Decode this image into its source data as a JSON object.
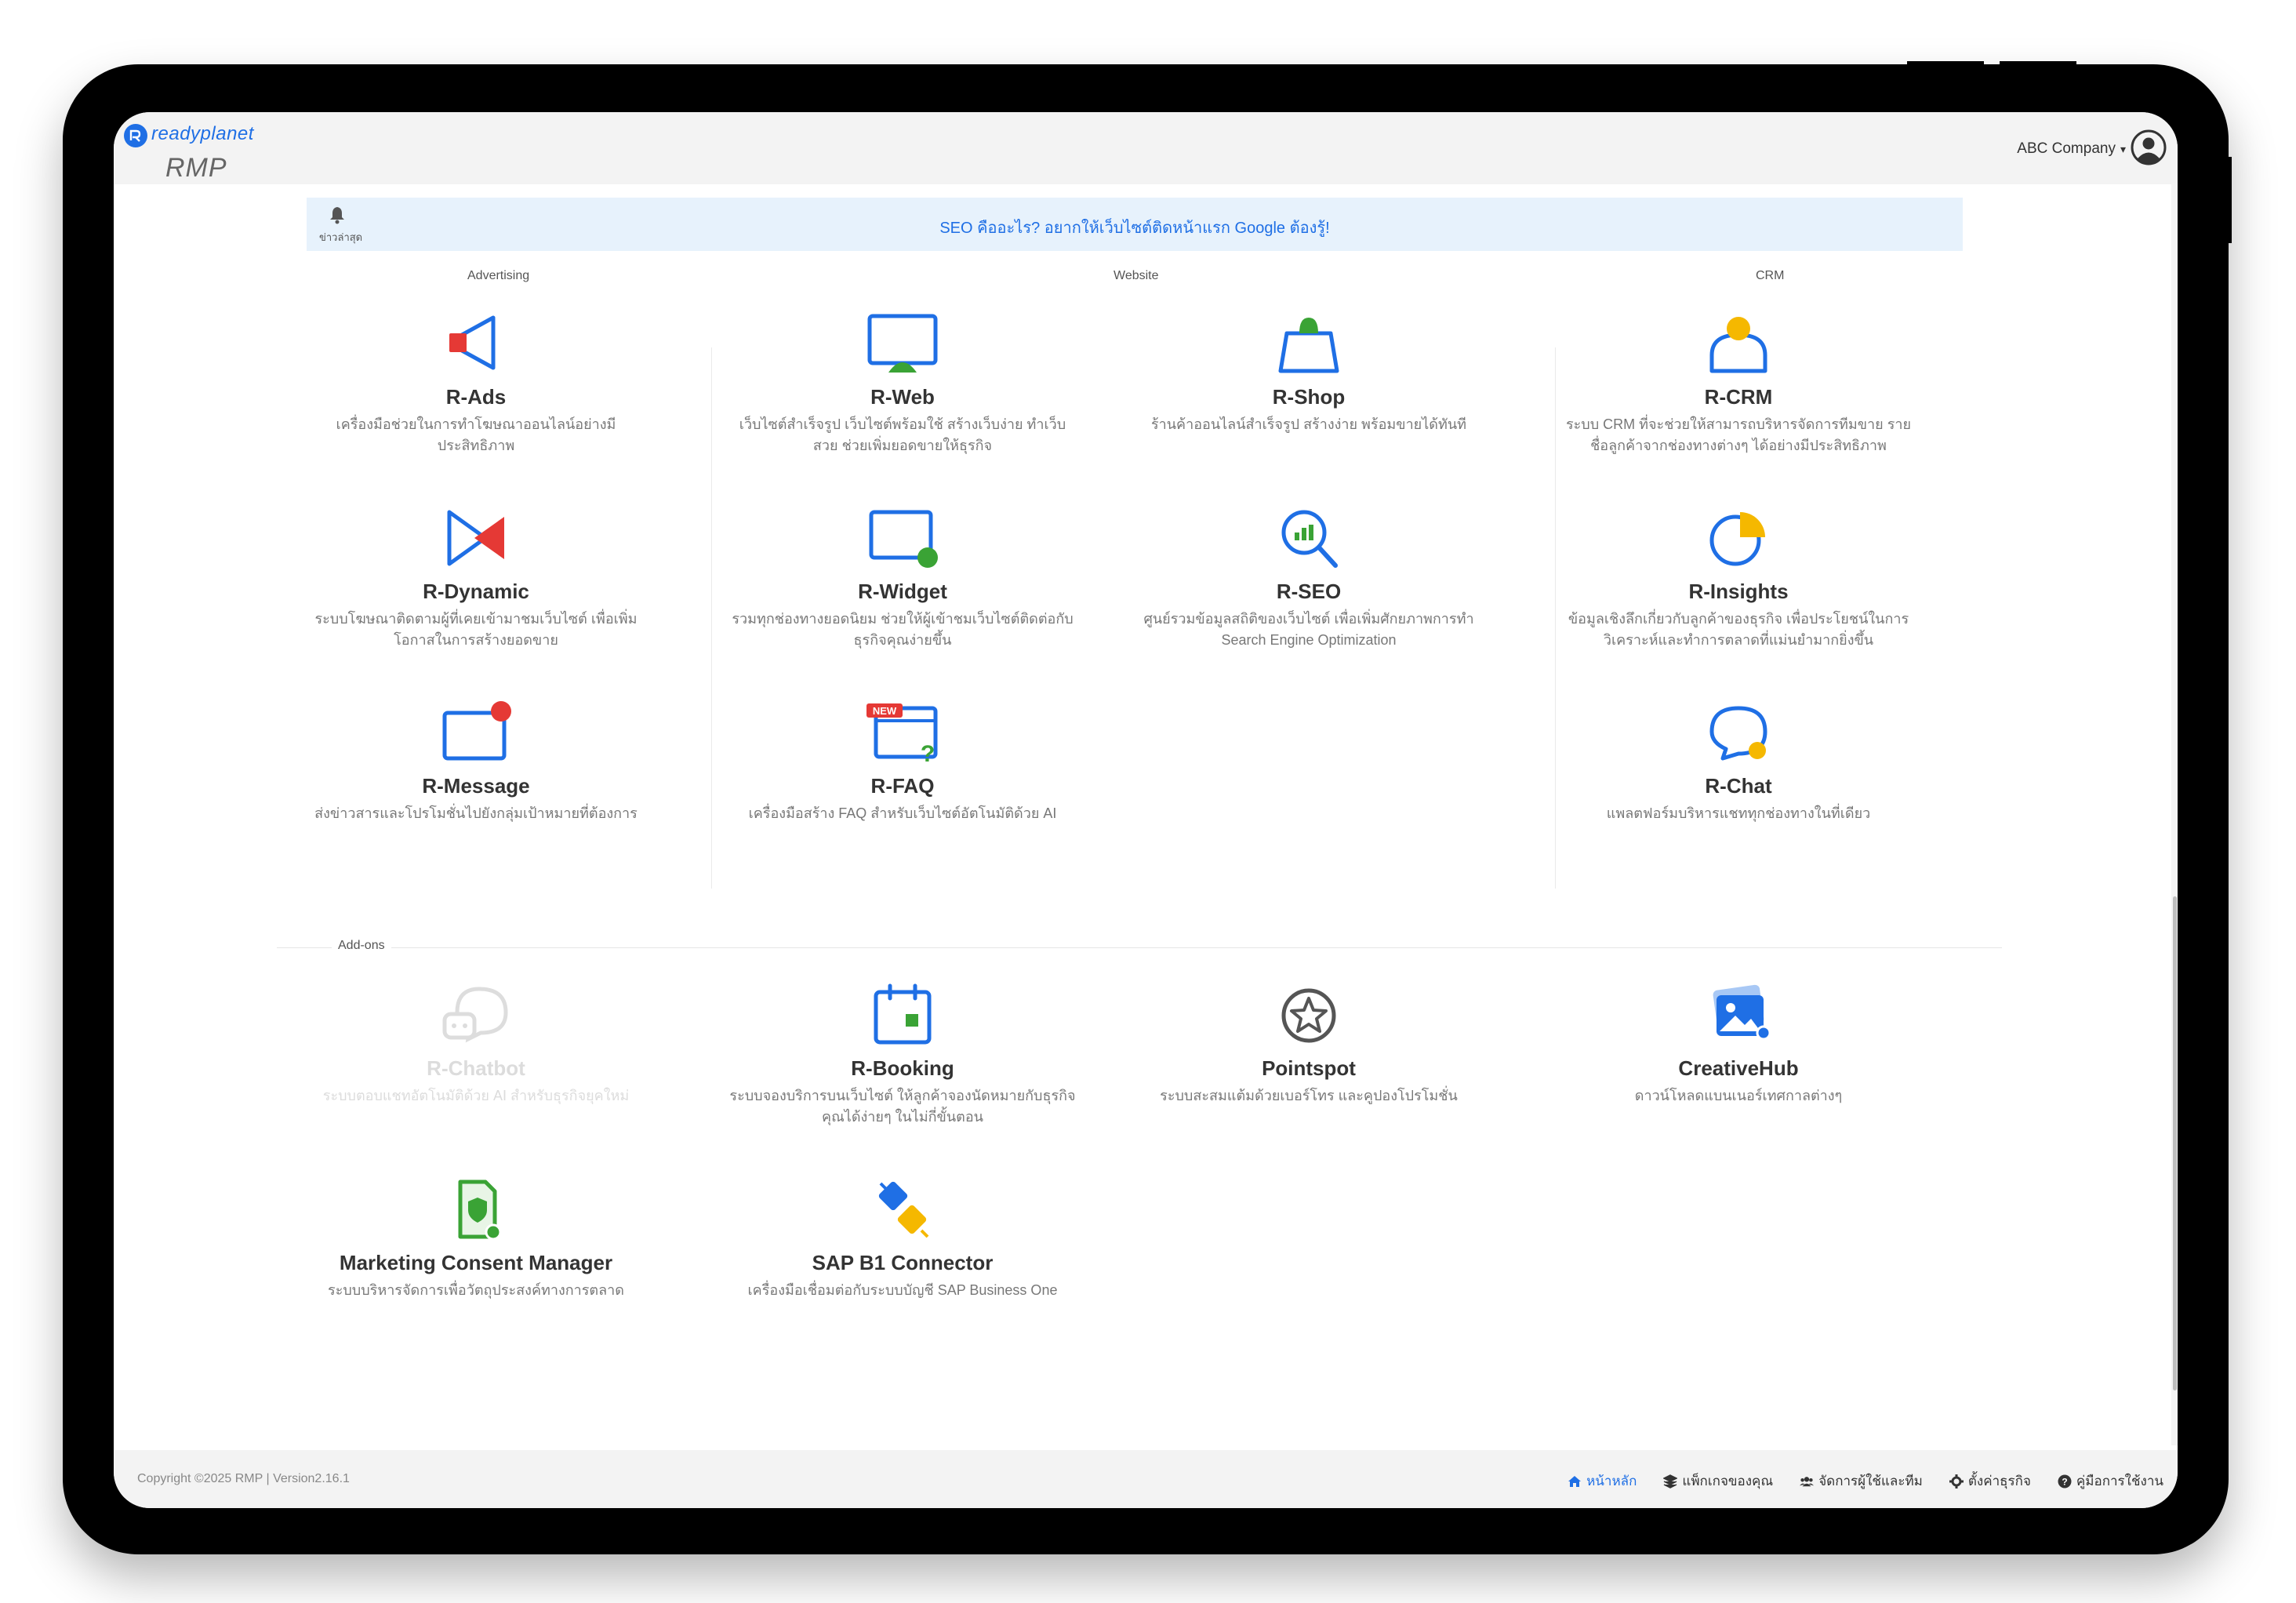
{
  "topbar": {
    "logo_word": "readyplanet",
    "logo_sub": "RMP",
    "company": "ABC Company"
  },
  "banner": {
    "bell_label": "ข่าวล่าสุด",
    "text": "SEO คืออะไร? อยากให้เว็บไซต์ติดหน้าแรก Google ต้องรู้!"
  },
  "sections": {
    "advertising": "Advertising",
    "website": "Website",
    "crm": "CRM",
    "addons": "Add-ons"
  },
  "apps": {
    "r_ads": {
      "name": "R-Ads",
      "desc": "เครื่องมือช่วยในการทำโฆษณาออนไลน์อย่างมีประสิทธิภาพ",
      "icon": "megaphone-icon"
    },
    "r_web": {
      "name": "R-Web",
      "desc": "เว็บไซต์สำเร็จรูป เว็บไซต์พร้อมใช้ สร้างเว็บง่าย ทำเว็บสวย ช่วยเพิ่มยอดขายให้ธุรกิจ",
      "icon": "monitor-icon"
    },
    "r_shop": {
      "name": "R-Shop",
      "desc": "ร้านค้าออนไลน์สำเร็จรูป สร้างง่าย พร้อมขายได้ทันที",
      "icon": "shopping-bag-icon"
    },
    "r_crm": {
      "name": "R-CRM",
      "desc": "ระบบ CRM ที่จะช่วยให้สามารถบริหารจัดการทีมขาย รายชื่อลูกค้าจากช่องทางต่างๆ ได้อย่างมีประสิทธิภาพ",
      "icon": "person-icon"
    },
    "r_dynamic": {
      "name": "R-Dynamic",
      "desc": "ระบบโฆษณาติดตามผู้ที่เคยเข้ามาชมเว็บไซต์ เพื่อเพิ่มโอกาสในการสร้างยอดขาย",
      "icon": "dynamic-ad-icon"
    },
    "r_widget": {
      "name": "R-Widget",
      "desc": "รวมทุกช่องทางยอดนิยม ช่วยให้ผู้เข้าชมเว็บไซต์ติดต่อกับธุรกิจคุณง่ายขึ้น",
      "icon": "widget-icon"
    },
    "r_seo": {
      "name": "R-SEO",
      "desc": "ศูนย์รวมข้อมูลสถิติของเว็บไซต์ เพื่อเพิ่มศักยภาพการทำ Search Engine Optimization",
      "icon": "magnifier-chart-icon"
    },
    "r_insights": {
      "name": "R-Insights",
      "desc": "ข้อมูลเชิงลึกเกี่ยวกับลูกค้าของธุรกิจ เพื่อประโยชน์ในการวิเคราะห์และทำการตลาดที่แม่นยำมากยิ่งขึ้น",
      "icon": "pie-chart-icon"
    },
    "r_message": {
      "name": "R-Message",
      "desc": "ส่งข่าวสารและโปรโมชั่นไปยังกลุ่มเป้าหมายที่ต้องการ",
      "icon": "message-window-icon"
    },
    "r_faq": {
      "name": "R-FAQ",
      "desc": "เครื่องมือสร้าง FAQ สำหรับเว็บไซต์อัตโนมัติด้วย AI",
      "icon": "faq-icon",
      "badge": "NEW"
    },
    "r_chat": {
      "name": "R-Chat",
      "desc": "แพลตฟอร์มบริหารแชททุกช่องทางในที่เดียว",
      "icon": "chat-bubble-icon"
    },
    "r_chatbot": {
      "name": "R-Chatbot",
      "desc": "ระบบตอบแชทอัตโนมัติด้วย AI สำหรับธุรกิจยุคใหม่",
      "icon": "chatbot-icon"
    },
    "r_booking": {
      "name": "R-Booking",
      "desc": "ระบบจองบริการบนเว็บไซต์ ให้ลูกค้าจองนัดหมายกับธุรกิจคุณได้ง่ายๆ ในไม่กี่ขั้นตอน",
      "icon": "calendar-icon"
    },
    "pointspot": {
      "name": "Pointspot",
      "desc": "ระบบสะสมแต้มด้วยเบอร์โทร และคูปองโปรโมชั่น",
      "icon": "star-circle-icon"
    },
    "creativehub": {
      "name": "CreativeHub",
      "desc": "ดาวน์โหลดแบนเนอร์เทศกาลต่างๆ",
      "icon": "image-gallery-icon"
    },
    "consent": {
      "name": "Marketing Consent Manager",
      "desc": "ระบบบริหารจัดการเพื่อวัตถุประสงค์ทางการตลาด",
      "icon": "consent-document-icon"
    },
    "sap": {
      "name": "SAP B1 Connector",
      "desc": "เครื่องมือเชื่อมต่อกับระบบบัญชี SAP Business One",
      "icon": "plug-connector-icon"
    }
  },
  "footer": {
    "copyright": "Copyright ©2025 RMP | Version2.16.1",
    "links": {
      "home": "หน้าหลัก",
      "package": "แพ็กเกจของคุณ",
      "users": "จัดการผู้ใช้และทีม",
      "settings": "ตั้งค่าธุรกิจ",
      "manual": "คู่มือการใช้งาน"
    }
  },
  "colors": {
    "accent": "#1f6fe5",
    "red": "#e53935",
    "green": "#3aa335",
    "yellow": "#f5b800",
    "banner_bg": "#e7f2fc"
  }
}
